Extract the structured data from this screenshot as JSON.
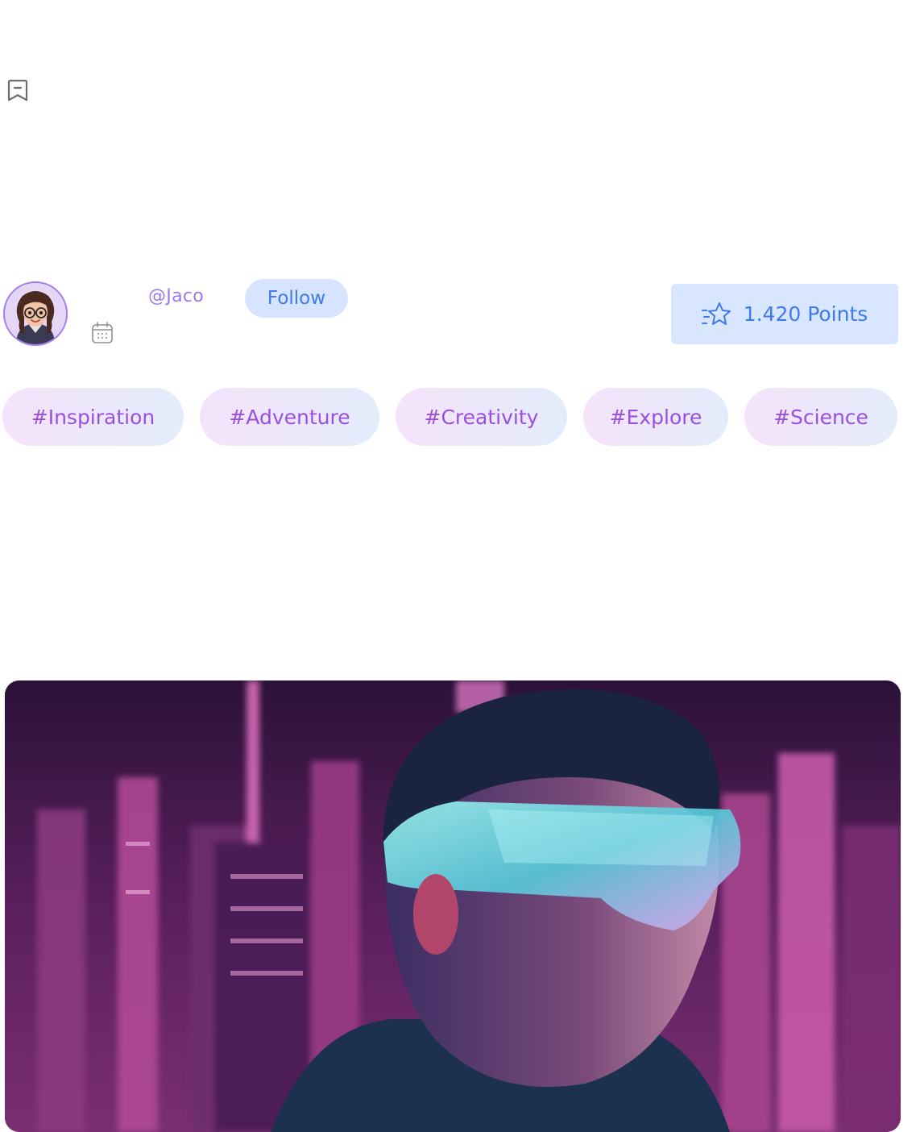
{
  "author": {
    "handle": "@Jaco",
    "follow_label": "Follow"
  },
  "points": {
    "label": "1.420 Points"
  },
  "tags": [
    "#Inspiration",
    "#Adventure",
    "#Creativity",
    "#Explore",
    "#Science"
  ],
  "icons": {
    "bookmark": "bookmark-icon",
    "calendar": "calendar-icon",
    "points": "star-icon"
  },
  "colors": {
    "accent_blue": "#3d7bea",
    "accent_purple": "#9a4fe0",
    "button_bg": "#d6e4ff"
  }
}
